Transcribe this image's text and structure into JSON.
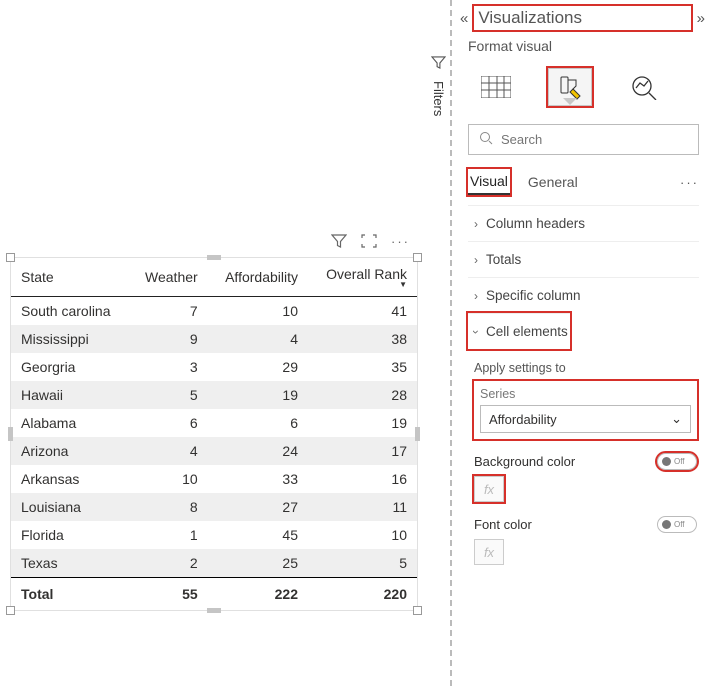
{
  "canvas": {
    "toolbar": {
      "filter_icon": "filter-icon",
      "focus_icon": "focus-mode-icon",
      "more_icon": "more-icon"
    },
    "table": {
      "columns": [
        "State",
        "Weather",
        "Affordability",
        "Overall Rank"
      ],
      "sort_column": 3,
      "rows": [
        {
          "state": "South carolina",
          "weather": 7,
          "affordability": 10,
          "overall": 41
        },
        {
          "state": "Mississippi",
          "weather": 9,
          "affordability": 4,
          "overall": 38
        },
        {
          "state": "Georgria",
          "weather": 3,
          "affordability": 29,
          "overall": 35
        },
        {
          "state": "Hawaii",
          "weather": 5,
          "affordability": 19,
          "overall": 28
        },
        {
          "state": "Alabama",
          "weather": 6,
          "affordability": 6,
          "overall": 19
        },
        {
          "state": "Arizona",
          "weather": 4,
          "affordability": 24,
          "overall": 17
        },
        {
          "state": "Arkansas",
          "weather": 10,
          "affordability": 33,
          "overall": 16
        },
        {
          "state": "Louisiana",
          "weather": 8,
          "affordability": 27,
          "overall": 11
        },
        {
          "state": "Florida",
          "weather": 1,
          "affordability": 45,
          "overall": 10
        },
        {
          "state": "Texas",
          "weather": 2,
          "affordability": 25,
          "overall": 5
        }
      ],
      "totals": {
        "label": "Total",
        "weather": 55,
        "affordability": 222,
        "overall": 220
      }
    }
  },
  "filters_tab": {
    "label": "Filters"
  },
  "viz_pane": {
    "title": "Visualizations",
    "subtitle": "Format visual",
    "search_placeholder": "Search",
    "tabs": {
      "visual": "Visual",
      "general": "General"
    },
    "sections": {
      "column_headers": "Column headers",
      "totals": "Totals",
      "specific_column": "Specific column",
      "cell_elements": "Cell elements"
    },
    "cell": {
      "apply_label": "Apply settings to",
      "series_label": "Series",
      "series_value": "Affordability",
      "bg_label": "Background color",
      "font_label": "Font color",
      "toggle_off": "Off",
      "fx": "fx"
    }
  }
}
